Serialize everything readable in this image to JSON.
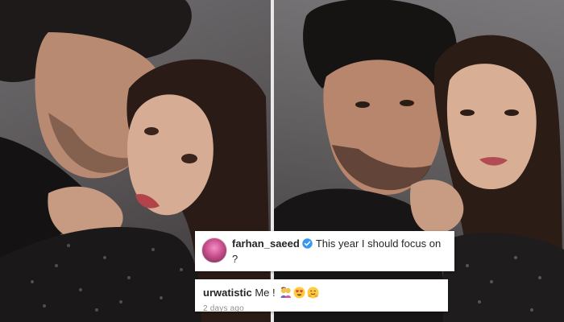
{
  "comment": {
    "username": "farhan_saeed",
    "text": "This year I should focus on ?",
    "avatar_icon": "profile-avatar",
    "verified_icon": "verified-badge-icon",
    "verified_color": "#3897f0"
  },
  "reply": {
    "username": "urwatistic",
    "text": "Me !",
    "emojis": [
      "couple-emoji",
      "heart-eyes-emoji",
      "hugging-face-emoji"
    ],
    "timestamp": "2 days ago"
  },
  "photos": {
    "left_description_icon": "photo-couple-left",
    "right_description_icon": "photo-couple-right"
  }
}
